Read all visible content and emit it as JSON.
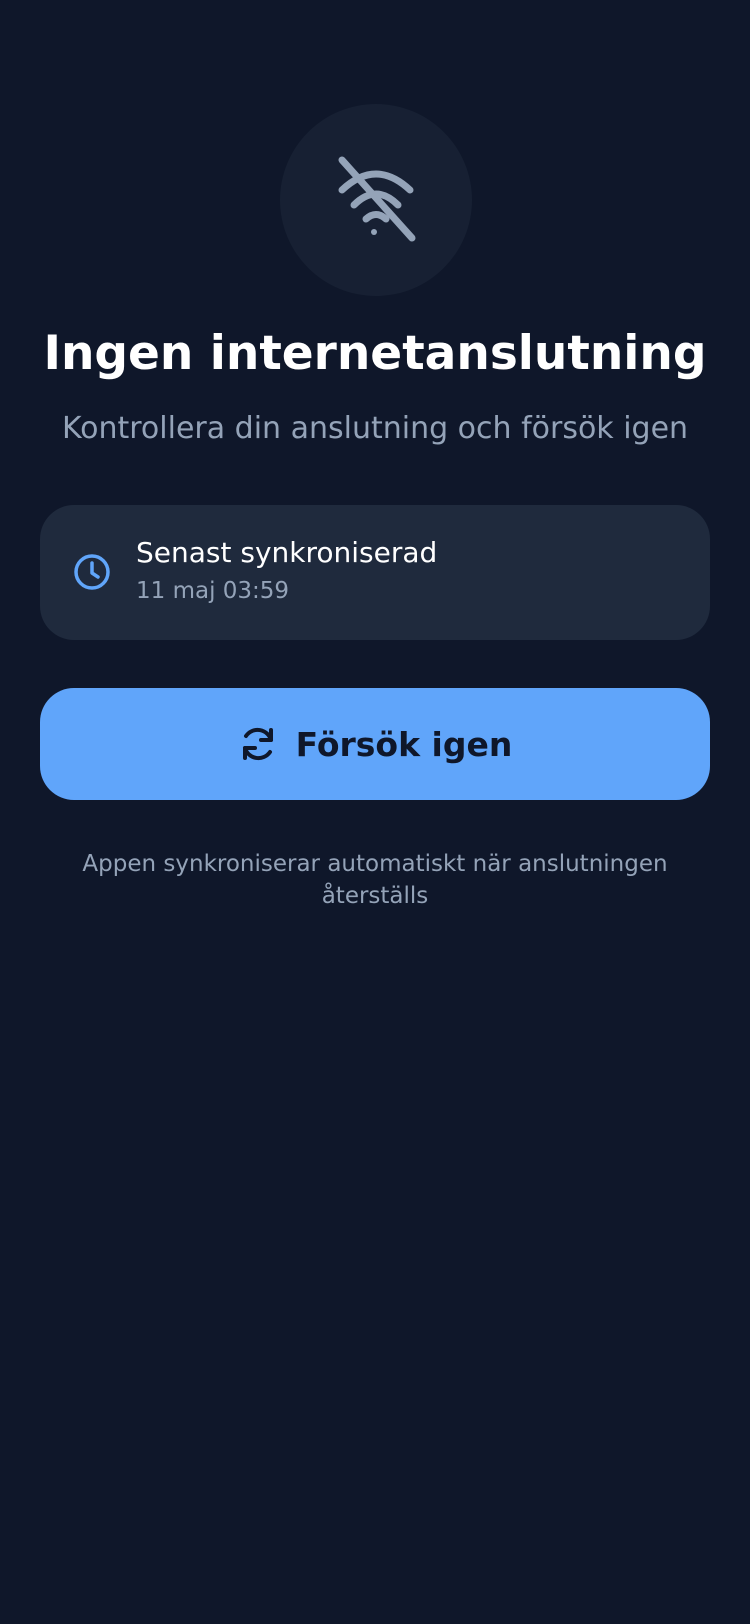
{
  "offline": {
    "icon": "wifi-off-icon",
    "title": "Ingen internetanslutning",
    "subtitle": "Kontrollera din anslutning och försök igen"
  },
  "sync_card": {
    "icon": "clock-icon",
    "label": "Senast synkroniserad",
    "timestamp": "11 maj 03:59"
  },
  "retry_button": {
    "icon": "refresh-icon",
    "label": "Försök igen"
  },
  "footer": {
    "note": "Appen synkroniserar automatiskt när anslutningen återställs"
  },
  "colors": {
    "background": "#0f172a",
    "icon_circle": "#172033",
    "card": "#1f2a3d",
    "accent": "#60a5fa",
    "muted_text": "#94a3b8",
    "primary_text": "#ffffff"
  }
}
